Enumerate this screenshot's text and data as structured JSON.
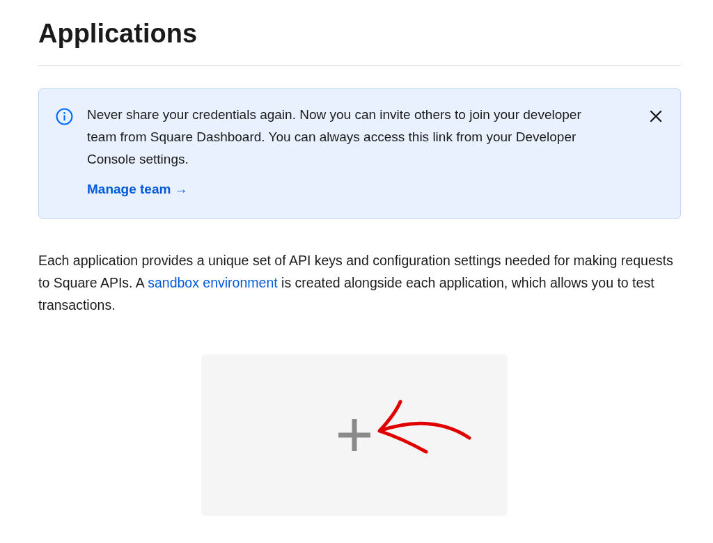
{
  "heading": "Applications",
  "banner": {
    "message": "Never share your credentials again. Now you can invite others to join your developer team from Square Dashboard. You can always access this link from your Developer Console settings.",
    "link": "Manage team →"
  },
  "description": {
    "before": "Each application provides a unique set of API keys and configuration settings needed for making requests to Square APIs. A ",
    "link": "sandbox environment",
    "after": " is created alongside each application, which allows you to test transactions."
  }
}
